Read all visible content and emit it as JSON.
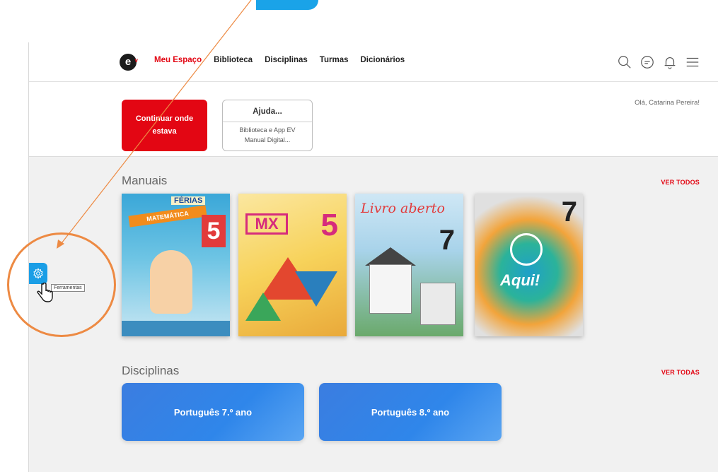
{
  "header": {
    "logo_text": "e",
    "nav": [
      {
        "label": "Meu Espaço",
        "active": true
      },
      {
        "label": "Biblioteca",
        "active": false
      },
      {
        "label": "Disciplinas",
        "active": false
      },
      {
        "label": "Turmas",
        "active": false
      },
      {
        "label": "Dicionários",
        "active": false
      }
    ],
    "icons": [
      "search-icon",
      "chat-icon",
      "notification-bell-icon",
      "menu-icon"
    ]
  },
  "greeting": "Olá, Catarina Pereira!",
  "continue_button": "Continuar onde estava",
  "help_card": {
    "title": "Ajuda...",
    "line1": "Biblioteca e App EV",
    "line2": "Manual Digital..."
  },
  "manuais": {
    "title": "Manuais",
    "see_all": "VER TODOS",
    "books": [
      {
        "banner": "MATEMÁTICA",
        "tag": "FÉRIAS",
        "grade": "5"
      },
      {
        "banner": "MX",
        "grade": "5"
      },
      {
        "banner": "Livro aberto",
        "grade": "7"
      },
      {
        "banner": "Aqui!",
        "grade": "7"
      }
    ]
  },
  "disciplinas": {
    "title": "Disciplinas",
    "see_all": "VER TODAS",
    "items": [
      {
        "label": "Português 7.º ano"
      },
      {
        "label": "Português 8.º ano"
      }
    ]
  },
  "tools": {
    "tooltip": "Ferramentas"
  },
  "colors": {
    "brand_red": "#e30613",
    "tool_blue": "#1a9ee6",
    "highlight_orange": "#ed8a43",
    "card_blue": "#2f86ea"
  }
}
